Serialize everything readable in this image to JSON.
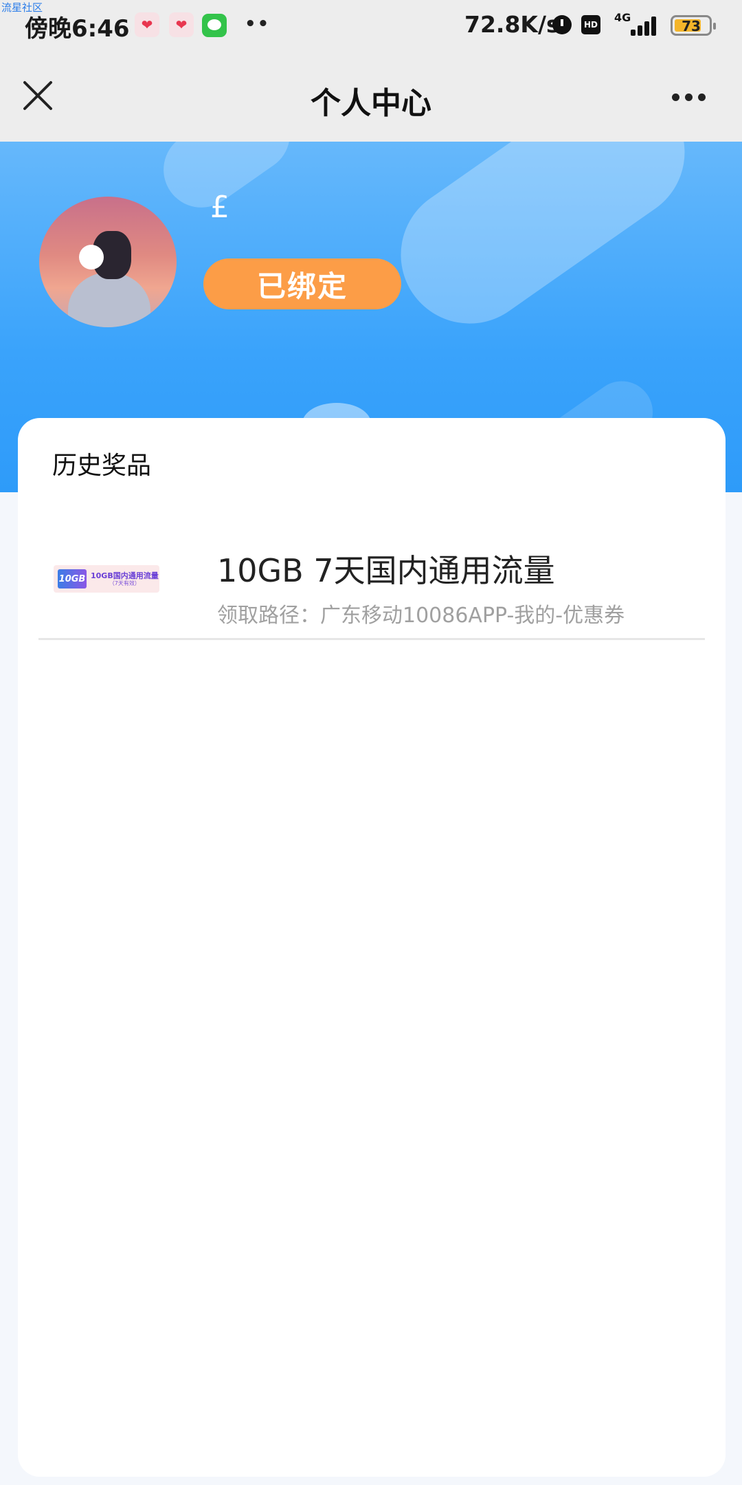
{
  "watermark": "流星社区",
  "status_bar": {
    "time": "傍晚6:46",
    "net_speed": "72.8K/s",
    "hd_label": "HD",
    "network_type": "4G",
    "battery": "73",
    "icons": [
      "heart-notification-icon",
      "heart-notification-icon",
      "message-app-icon",
      "more-notifications-icon",
      "alarm-icon",
      "hd-icon",
      "signal-icon",
      "battery-icon"
    ]
  },
  "nav": {
    "title": "个人中心",
    "close_icon": "close-icon",
    "more_icon": "more-icon"
  },
  "profile": {
    "name": "£",
    "bind_status": "已绑定"
  },
  "history": {
    "title": "历史奖品",
    "items": [
      {
        "thumb_gb": "10GB",
        "thumb_line1": "10GB国内通用流量",
        "thumb_line2": "（7天有效）",
        "name": "10GB 7天国内通用流量",
        "path": "领取路径：广东移动10086APP-我的-优惠券"
      }
    ]
  },
  "colors": {
    "banner": "#3aa3fb",
    "bind_badge": "#fc9d47",
    "nav_bg": "#ededed",
    "page_bg": "#f4f7fc"
  }
}
